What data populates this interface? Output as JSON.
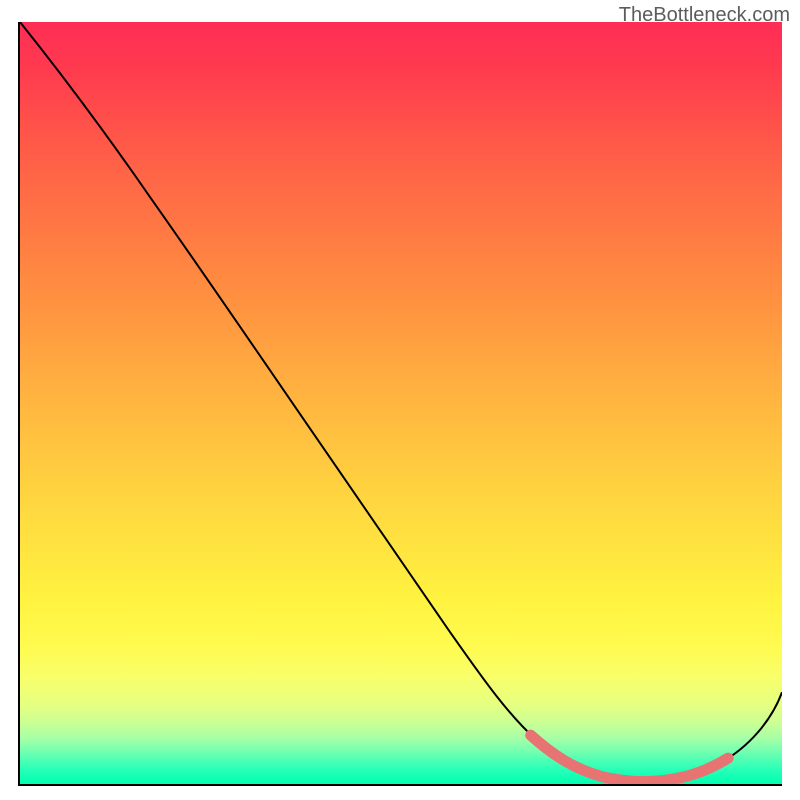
{
  "watermark": "TheBottleneck.com",
  "chart_data": {
    "type": "line",
    "title": "",
    "xlabel": "",
    "ylabel": "",
    "xlim": [
      0,
      100
    ],
    "ylim": [
      0,
      100
    ],
    "grid": false,
    "series": [
      {
        "name": "bottleneck-curve",
        "x": [
          0,
          10,
          20,
          30,
          40,
          50,
          60,
          65,
          68,
          72,
          76,
          80,
          84,
          88,
          92,
          96,
          100
        ],
        "values": [
          100,
          89,
          77,
          64,
          50,
          36,
          22,
          13,
          8,
          4,
          1,
          0,
          0,
          1,
          3,
          7,
          14
        ]
      },
      {
        "name": "optimal-segment",
        "x": [
          68,
          72,
          76,
          80,
          84,
          88
        ],
        "values": [
          8,
          4,
          1,
          0,
          0,
          1
        ]
      }
    ],
    "gradient_stops": [
      {
        "pct": 0,
        "color": "#ff2d55"
      },
      {
        "pct": 50,
        "color": "#ffc040"
      },
      {
        "pct": 82,
        "color": "#fffb50"
      },
      {
        "pct": 100,
        "color": "#00ffb0"
      }
    ],
    "optimal_highlight_color": "#e77373"
  }
}
